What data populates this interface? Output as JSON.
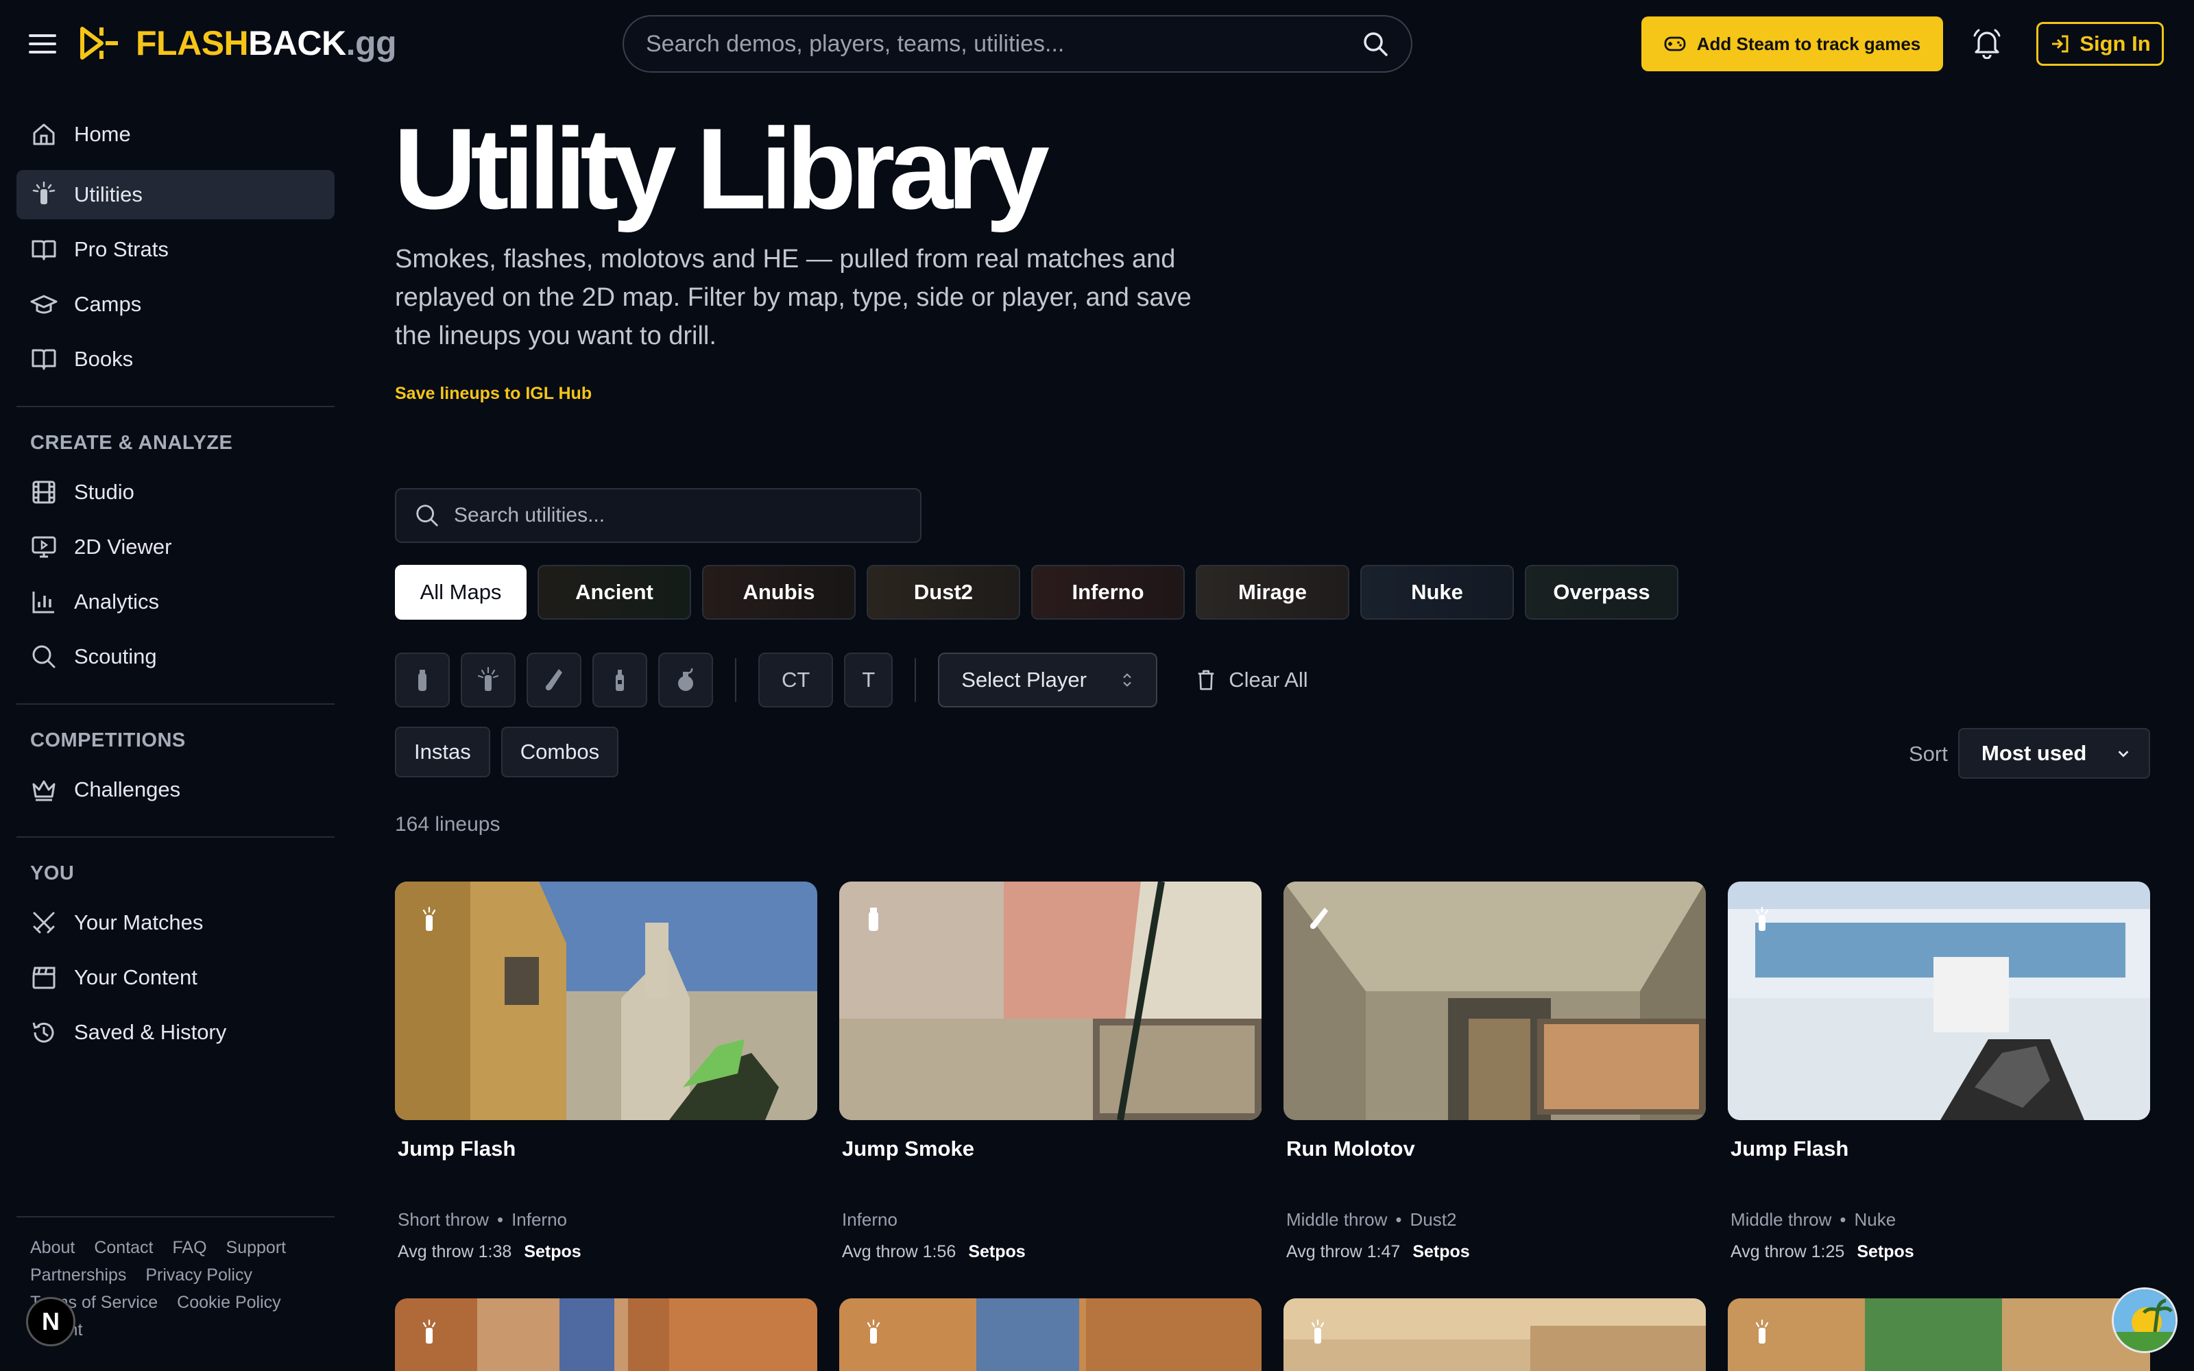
{
  "brand": {
    "logo_part1": "FLASH",
    "logo_part2": "BACK",
    "logo_part3": ".gg",
    "accent_color": "#f5c518"
  },
  "topbar": {
    "search_placeholder": "Search demos, players, teams, utilities...",
    "steam_label": "Add Steam to track games",
    "signin_label": "Sign In"
  },
  "sidebar": {
    "main": [
      {
        "label": "Home",
        "icon": "home-icon"
      },
      {
        "label": "Utilities",
        "icon": "flashbang-icon",
        "active": true
      },
      {
        "label": "Pro Strats",
        "icon": "book-open-icon"
      },
      {
        "label": "Camps",
        "icon": "graduation-cap-icon"
      },
      {
        "label": "Books",
        "icon": "book-icon"
      }
    ],
    "create_heading": "CREATE & ANALYZE",
    "create": [
      {
        "label": "Studio",
        "icon": "film-icon"
      },
      {
        "label": "2D Viewer",
        "icon": "monitor-play-icon"
      },
      {
        "label": "Analytics",
        "icon": "bar-chart-icon"
      },
      {
        "label": "Scouting",
        "icon": "search-icon"
      }
    ],
    "competitions_heading": "COMPETITIONS",
    "competitions": [
      {
        "label": "Challenges",
        "icon": "crown-icon"
      }
    ],
    "you_heading": "YOU",
    "you": [
      {
        "label": "Your Matches",
        "icon": "swords-icon"
      },
      {
        "label": "Your Content",
        "icon": "clapperboard-icon"
      },
      {
        "label": "Saved & History",
        "icon": "history-icon"
      }
    ],
    "footer": [
      "About",
      "Contact",
      "FAQ",
      "Support",
      "Partnerships",
      "Privacy Policy",
      "Terms of Service",
      "Cookie Policy",
      "Imprint"
    ],
    "n_badge": "N"
  },
  "main": {
    "title": "Utility Library",
    "description": "Smokes, flashes, molotovs and HE — pulled from real matches and replayed on the 2D map. Filter by map, type, side or player, and save the lineups you want to drill.",
    "igl_link": "Save lineups to IGL Hub",
    "search_placeholder": "Search utilities...",
    "maps": [
      "All Maps",
      "Ancient",
      "Anubis",
      "Dust2",
      "Inferno",
      "Mirage",
      "Nuke",
      "Overpass"
    ],
    "utility_types": [
      "smoke-grenade-icon",
      "flashbang-icon",
      "molotov-icon",
      "decoy-icon",
      "he-grenade-icon"
    ],
    "sides": [
      "CT",
      "T"
    ],
    "player_select": "Select Player",
    "clear_all": "Clear All",
    "toggles": [
      "Instas",
      "Combos"
    ],
    "sort_label": "Sort",
    "sort_value": "Most used",
    "count": "164 lineups"
  },
  "cards": [
    {
      "title": "Jump Flash",
      "throw": "Short throw",
      "map": "Inferno",
      "avg": "Avg throw 1:38",
      "player": "Setpos",
      "icon": "flashbang-icon"
    },
    {
      "title": "Jump Smoke",
      "throw": "",
      "map": "Inferno",
      "avg": "Avg throw 1:56",
      "player": "Setpos",
      "icon": "smoke-grenade-icon"
    },
    {
      "title": "Run Molotov",
      "throw": "Middle throw",
      "map": "Dust2",
      "avg": "Avg throw 1:47",
      "player": "Setpos",
      "icon": "molotov-icon"
    },
    {
      "title": "Jump Flash",
      "throw": "Middle throw",
      "map": "Nuke",
      "avg": "Avg throw 1:25",
      "player": "Setpos",
      "icon": "flashbang-icon"
    }
  ]
}
